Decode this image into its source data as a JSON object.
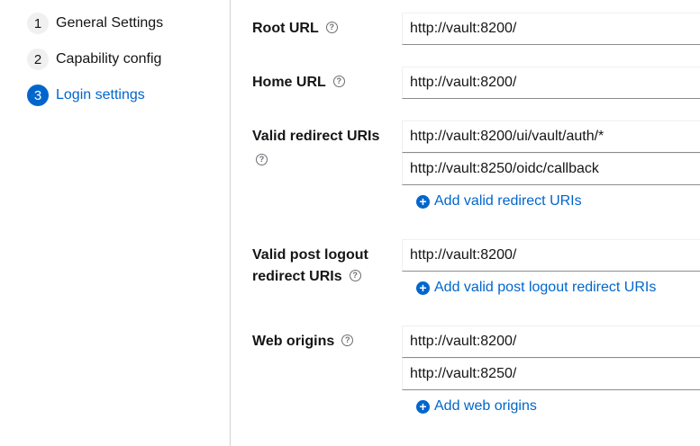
{
  "wizard": {
    "steps": [
      {
        "number": "1",
        "label": "General Settings",
        "active": false
      },
      {
        "number": "2",
        "label": "Capability config",
        "active": false
      },
      {
        "number": "3",
        "label": "Login settings",
        "active": true
      }
    ]
  },
  "form": {
    "root_url": {
      "label": "Root URL",
      "value": "http://vault:8200/"
    },
    "home_url": {
      "label": "Home URL",
      "value": "http://vault:8200/"
    },
    "redirect_uris": {
      "label": "Valid redirect URIs",
      "values": [
        "http://vault:8200/ui/vault/auth/*",
        "http://vault:8250/oidc/callback"
      ],
      "add_label": "Add valid redirect URIs"
    },
    "post_logout": {
      "label_line1": "Valid post logout",
      "label_line2": "redirect URIs",
      "values": [
        "http://vault:8200/"
      ],
      "add_label": "Add valid post logout redirect URIs"
    },
    "web_origins": {
      "label": "Web origins",
      "values": [
        "http://vault:8200/",
        "http://vault:8250/"
      ],
      "add_label": "Add web origins"
    }
  },
  "icons": {
    "help": "help-circle-icon",
    "add": "plus-circle-icon"
  },
  "colors": {
    "accent": "#0066cc",
    "text": "#151515",
    "muted": "#6a6e73"
  }
}
